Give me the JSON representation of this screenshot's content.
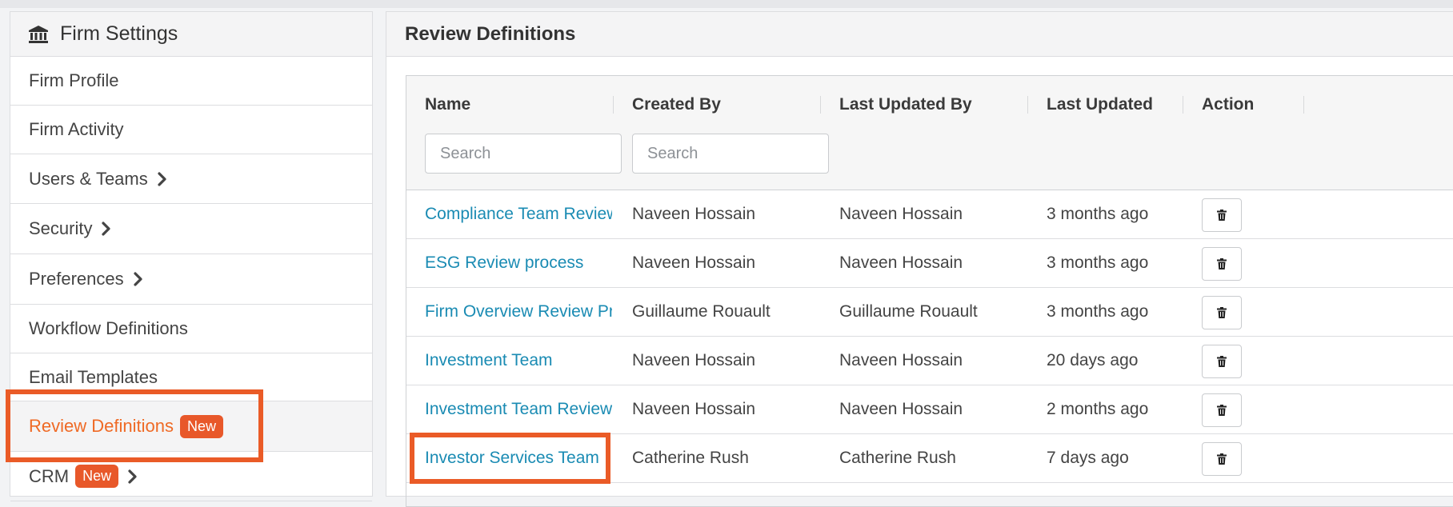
{
  "sidebar": {
    "title": "Firm Settings",
    "title_icon": "institution-icon",
    "items": [
      {
        "label": "Firm Profile",
        "chevron": false,
        "badge": ""
      },
      {
        "label": "Firm Activity",
        "chevron": false,
        "badge": ""
      },
      {
        "label": "Users & Teams",
        "chevron": true,
        "badge": ""
      },
      {
        "label": "Security",
        "chevron": true,
        "badge": ""
      },
      {
        "label": "Preferences",
        "chevron": true,
        "badge": ""
      },
      {
        "label": "Workflow Definitions",
        "chevron": false,
        "badge": ""
      },
      {
        "label": "Email Templates",
        "chevron": false,
        "badge": ""
      },
      {
        "label": "Review Definitions",
        "chevron": false,
        "badge": "New",
        "active": true
      },
      {
        "label": "CRM",
        "chevron": true,
        "badge": "New"
      }
    ]
  },
  "main": {
    "title": "Review Definitions",
    "columns": {
      "name": "Name",
      "created_by": "Created By",
      "last_updated_by": "Last Updated By",
      "last_updated": "Last Updated",
      "action": "Action"
    },
    "search_placeholder": "Search",
    "rows": [
      {
        "name": "Compliance Team Review",
        "created_by": "Naveen Hossain",
        "last_updated_by": "Naveen Hossain",
        "last_updated": "3 months ago"
      },
      {
        "name": "ESG Review process",
        "created_by": "Naveen Hossain",
        "last_updated_by": "Naveen Hossain",
        "last_updated": "3 months ago"
      },
      {
        "name": "Firm Overview Review Process",
        "created_by": "Guillaume Rouault",
        "last_updated_by": "Guillaume Rouault",
        "last_updated": "3 months ago"
      },
      {
        "name": "Investment Team",
        "created_by": "Naveen Hossain",
        "last_updated_by": "Naveen Hossain",
        "last_updated": "20 days ago"
      },
      {
        "name": "Investment Team Review",
        "created_by": "Naveen Hossain",
        "last_updated_by": "Naveen Hossain",
        "last_updated": "2 months ago"
      },
      {
        "name": "Investor Services Team",
        "created_by": "Catherine Rush",
        "last_updated_by": "Catherine Rush",
        "last_updated": "7 days ago"
      }
    ]
  },
  "colors": {
    "accent": "#ef6a25",
    "badge": "#e8582a",
    "link": "#1a8bb3",
    "highlight": "#ea5b27"
  }
}
